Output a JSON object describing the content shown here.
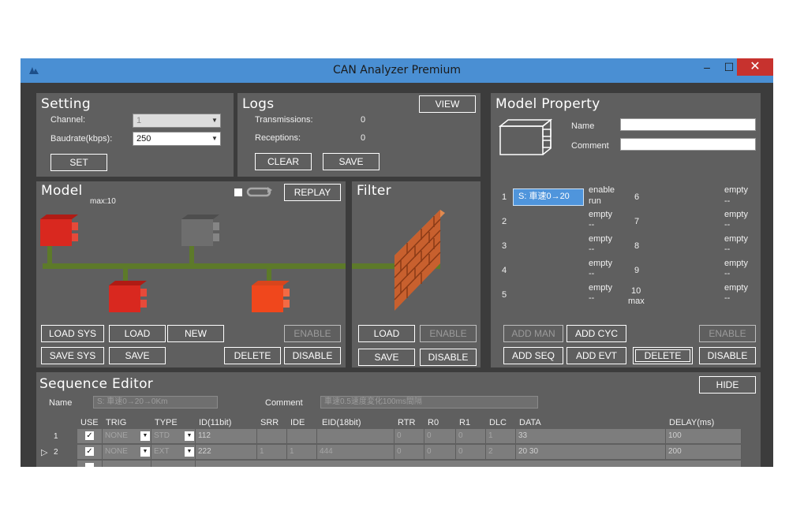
{
  "window": {
    "title": "CAN Analyzer Premium",
    "minimize": "–",
    "maximize": "☐",
    "close": "✕"
  },
  "setting": {
    "title": "Setting",
    "channel_label": "Channel:",
    "channel_value": "1",
    "baud_label": "Baudrate(kbps):",
    "baud_value": "250",
    "set_button": "SET"
  },
  "logs": {
    "title": "Logs",
    "view_button": "VIEW",
    "transmissions_label": "Transmissions:",
    "transmissions_value": "0",
    "receptions_label": "Receptions:",
    "receptions_value": "0",
    "clear_button": "CLEAR",
    "save_button": "SAVE"
  },
  "model": {
    "title": "Model",
    "max_label": "max:10",
    "replay_button": "REPLAY",
    "buttons": {
      "load_sys": "LOAD SYS",
      "load": "LOAD",
      "new": "NEW",
      "enable": "ENABLE",
      "save_sys": "SAVE SYS",
      "save": "SAVE",
      "delete": "DELETE",
      "disable": "DISABLE"
    }
  },
  "filter": {
    "title": "Filter",
    "load": "LOAD",
    "enable": "ENABLE",
    "save": "SAVE",
    "disable": "DISABLE"
  },
  "model_property": {
    "title": "Model Property",
    "name_label": "Name",
    "comment_label": "Comment",
    "slots_left": [
      {
        "num": "1",
        "state": "enable",
        "sub": "run",
        "selected_text": "S: 車速0→20"
      },
      {
        "num": "2",
        "state": "empty",
        "sub": "--"
      },
      {
        "num": "3",
        "state": "empty",
        "sub": "--"
      },
      {
        "num": "4",
        "state": "empty",
        "sub": "--"
      },
      {
        "num": "5",
        "state": "empty",
        "sub": "--"
      }
    ],
    "slots_right": [
      {
        "num": "6",
        "state": "empty",
        "sub": "--"
      },
      {
        "num": "7",
        "state": "empty",
        "sub": "--"
      },
      {
        "num": "8",
        "state": "empty",
        "sub": "--"
      },
      {
        "num": "9",
        "state": "empty",
        "sub": "--"
      },
      {
        "num": "10",
        "state": "empty",
        "sub": "--",
        "extra": "max"
      }
    ],
    "buttons": {
      "add_man": "ADD MAN",
      "add_cyc": "ADD CYC",
      "enable": "ENABLE",
      "add_seq": "ADD SEQ",
      "add_evt": "ADD EVT",
      "delete": "DELETE",
      "disable": "DISABLE"
    }
  },
  "sequence_editor": {
    "title": "Sequence Editor",
    "hide_button": "HIDE",
    "name_label": "Name",
    "name_value": "S: 車速0→20→0Km",
    "comment_label": "Comment",
    "comment_value": "車速0.5速度変化100ms間隔",
    "headers": [
      "USE",
      "TRIG",
      "TYPE",
      "ID(11bit)",
      "SRR",
      "IDE",
      "EID(18bit)",
      "RTR",
      "R0",
      "R1",
      "DLC",
      "DATA",
      "DELAY(ms)"
    ],
    "rows": [
      {
        "marker": "",
        "num": "1",
        "trig": "NONE",
        "type": "STD",
        "id": "112",
        "srr": "",
        "ide": "",
        "eid": "",
        "rtr": "0",
        "r0": "0",
        "r1": "0",
        "dlc": "1",
        "data": "33",
        "delay": "100"
      },
      {
        "marker": "▷",
        "num": "2",
        "trig": "NONE",
        "type": "EXT",
        "id": "222",
        "srr": "1",
        "ide": "1",
        "eid": "444",
        "rtr": "0",
        "r0": "0",
        "r1": "0",
        "dlc": "2",
        "data": "20 30",
        "delay": "200"
      }
    ]
  },
  "colors": {
    "accent": "#4a8fd3",
    "panel": "#5f5f5f",
    "background": "#3c3c3c",
    "close": "#c7322e",
    "node_red": "#d9281f",
    "node_gray": "#6e6e6e",
    "bus_green": "#5d7a2a",
    "brick": "#c8602e"
  }
}
